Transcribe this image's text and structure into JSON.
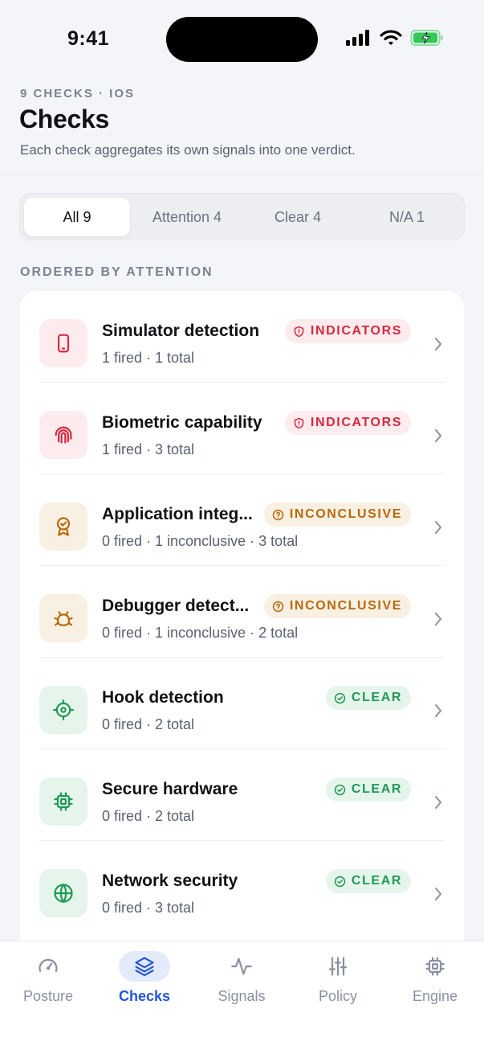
{
  "status_bar": {
    "time": "9:41"
  },
  "header": {
    "eyebrow": "9 CHECKS · IOS",
    "title": "Checks",
    "subtitle": "Each check aggregates its own signals into one verdict."
  },
  "filters": [
    {
      "label": "All 9",
      "active": true
    },
    {
      "label": "Attention 4",
      "active": false
    },
    {
      "label": "Clear 4",
      "active": false
    },
    {
      "label": "N/A 1",
      "active": false
    }
  ],
  "section_label": "ORDERED BY ATTENTION",
  "checks": [
    {
      "title": "Simulator detection",
      "subtitle": "1 fired · 1 total",
      "badge": "INDICATORS",
      "status": "indicators",
      "icon": "phone-icon"
    },
    {
      "title": "Biometric capability",
      "subtitle": "1 fired · 3 total",
      "badge": "INDICATORS",
      "status": "indicators",
      "icon": "fingerprint-icon"
    },
    {
      "title": "Application integ...",
      "subtitle": "0 fired · 1 inconclusive · 3 total",
      "badge": "INCONCLUSIVE",
      "status": "inconclusive",
      "icon": "award-icon"
    },
    {
      "title": "Debugger detect...",
      "subtitle": "0 fired · 1 inconclusive · 2 total",
      "badge": "INCONCLUSIVE",
      "status": "inconclusive",
      "icon": "bug-icon"
    },
    {
      "title": "Hook detection",
      "subtitle": "0 fired · 2 total",
      "badge": "CLEAR",
      "status": "clear",
      "icon": "crosshair-icon"
    },
    {
      "title": "Secure hardware",
      "subtitle": "0 fired · 2 total",
      "badge": "CLEAR",
      "status": "clear",
      "icon": "chip-icon"
    },
    {
      "title": "Network security",
      "subtitle": "0 fired · 3 total",
      "badge": "CLEAR",
      "status": "clear",
      "icon": "globe-icon"
    }
  ],
  "tabs": [
    {
      "label": "Posture",
      "icon": "gauge-icon",
      "active": false
    },
    {
      "label": "Checks",
      "icon": "layers-icon",
      "active": true
    },
    {
      "label": "Signals",
      "icon": "activity-icon",
      "active": false
    },
    {
      "label": "Policy",
      "icon": "sliders-icon",
      "active": false
    },
    {
      "label": "Engine",
      "icon": "cpu-icon",
      "active": false
    }
  ],
  "colors": {
    "indicators": "#d8283e",
    "inconclusive": "#b86a0c",
    "clear": "#1f9a55",
    "accent": "#2456d6"
  }
}
